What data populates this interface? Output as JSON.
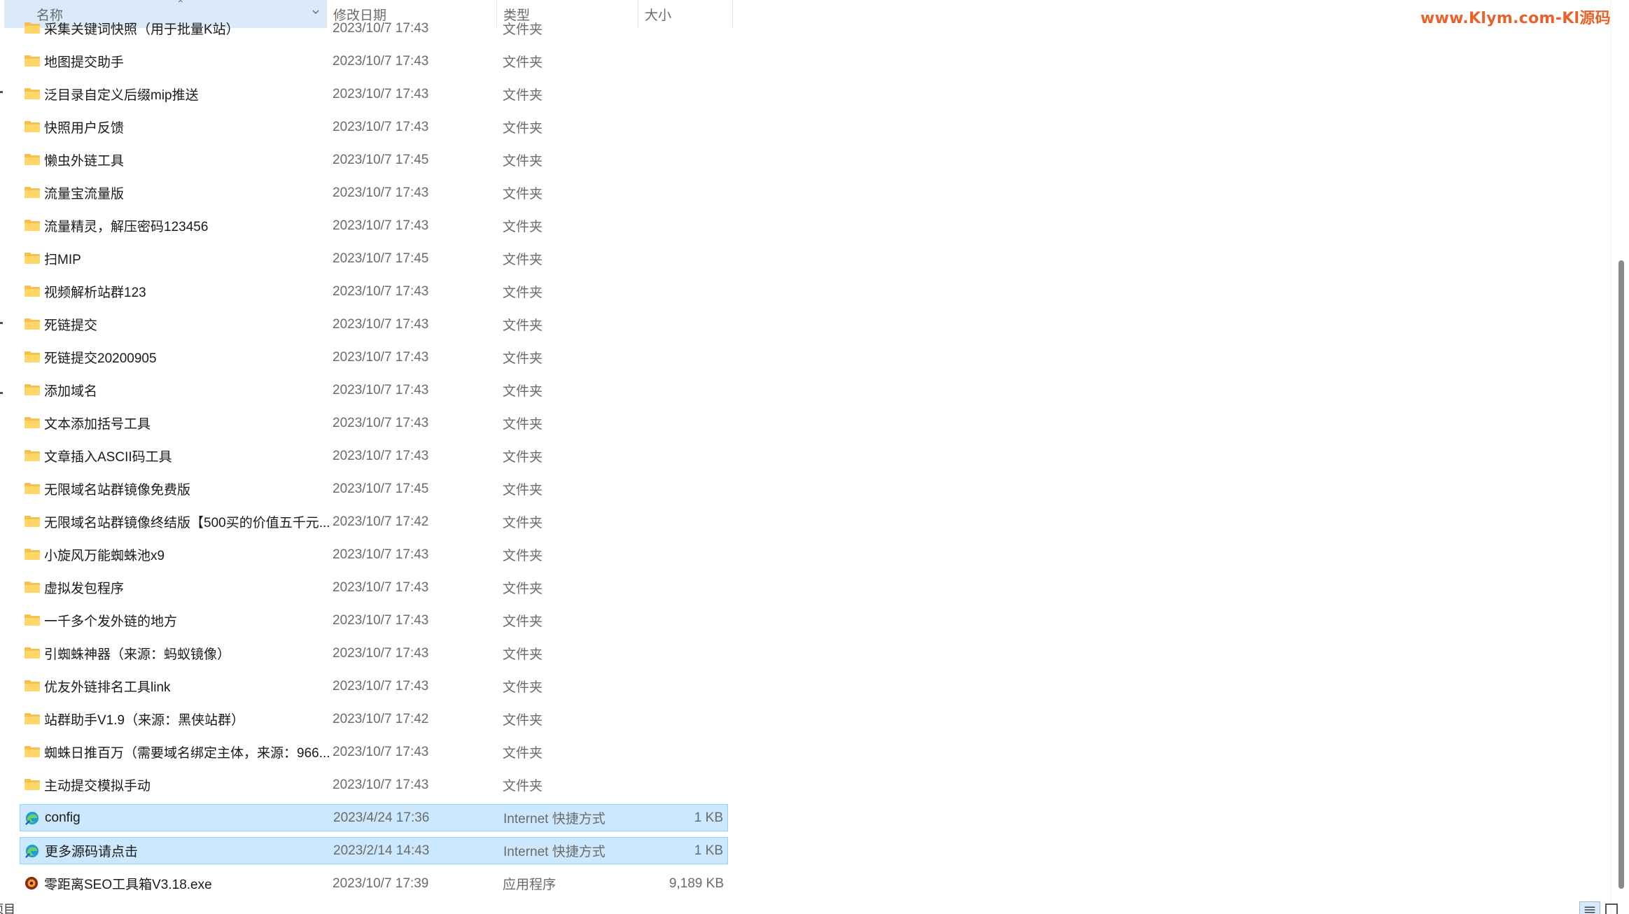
{
  "watermark": "www.Klym.com-Kl源码",
  "columns": {
    "name": "名称",
    "date": "修改日期",
    "type": "类型",
    "size": "大小"
  },
  "rows": [
    {
      "name": "采集关键词快照（用于批量K站）",
      "date": "2023/10/7 17:43",
      "type": "文件夹",
      "size": "",
      "icon": "folder-icon"
    },
    {
      "name": "地图提交助手",
      "date": "2023/10/7 17:43",
      "type": "文件夹",
      "size": "",
      "icon": "folder-icon"
    },
    {
      "name": "泛目录自定义后缀mip推送",
      "date": "2023/10/7 17:43",
      "type": "文件夹",
      "size": "",
      "icon": "folder-icon"
    },
    {
      "name": "快照用户反馈",
      "date": "2023/10/7 17:43",
      "type": "文件夹",
      "size": "",
      "icon": "folder-icon"
    },
    {
      "name": "懒虫外链工具",
      "date": "2023/10/7 17:45",
      "type": "文件夹",
      "size": "",
      "icon": "folder-icon"
    },
    {
      "name": "流量宝流量版",
      "date": "2023/10/7 17:43",
      "type": "文件夹",
      "size": "",
      "icon": "folder-icon"
    },
    {
      "name": "流量精灵，解压密码123456",
      "date": "2023/10/7 17:43",
      "type": "文件夹",
      "size": "",
      "icon": "folder-icon"
    },
    {
      "name": "扫MIP",
      "date": "2023/10/7 17:45",
      "type": "文件夹",
      "size": "",
      "icon": "folder-icon"
    },
    {
      "name": "视频解析站群123",
      "date": "2023/10/7 17:43",
      "type": "文件夹",
      "size": "",
      "icon": "folder-icon"
    },
    {
      "name": "死链提交",
      "date": "2023/10/7 17:43",
      "type": "文件夹",
      "size": "",
      "icon": "folder-icon"
    },
    {
      "name": "死链提交20200905",
      "date": "2023/10/7 17:43",
      "type": "文件夹",
      "size": "",
      "icon": "folder-icon"
    },
    {
      "name": "添加域名",
      "date": "2023/10/7 17:43",
      "type": "文件夹",
      "size": "",
      "icon": "folder-icon"
    },
    {
      "name": "文本添加括号工具",
      "date": "2023/10/7 17:43",
      "type": "文件夹",
      "size": "",
      "icon": "folder-icon"
    },
    {
      "name": "文章插入ASCII码工具",
      "date": "2023/10/7 17:43",
      "type": "文件夹",
      "size": "",
      "icon": "folder-icon"
    },
    {
      "name": "无限域名站群镜像免费版",
      "date": "2023/10/7 17:45",
      "type": "文件夹",
      "size": "",
      "icon": "folder-icon"
    },
    {
      "name": "无限域名站群镜像终结版【500买的价值五千元...",
      "date": "2023/10/7 17:42",
      "type": "文件夹",
      "size": "",
      "icon": "folder-icon"
    },
    {
      "name": "小旋风万能蜘蛛池x9",
      "date": "2023/10/7 17:43",
      "type": "文件夹",
      "size": "",
      "icon": "folder-icon"
    },
    {
      "name": "虚拟发包程序",
      "date": "2023/10/7 17:43",
      "type": "文件夹",
      "size": "",
      "icon": "folder-icon"
    },
    {
      "name": "一千多个发外链的地方",
      "date": "2023/10/7 17:43",
      "type": "文件夹",
      "size": "",
      "icon": "folder-icon"
    },
    {
      "name": "引蜘蛛神器（来源：蚂蚁镜像）",
      "date": "2023/10/7 17:43",
      "type": "文件夹",
      "size": "",
      "icon": "folder-icon"
    },
    {
      "name": "优友外链排名工具link",
      "date": "2023/10/7 17:43",
      "type": "文件夹",
      "size": "",
      "icon": "folder-icon"
    },
    {
      "name": "站群助手V1.9（来源：黑侠站群）",
      "date": "2023/10/7 17:42",
      "type": "文件夹",
      "size": "",
      "icon": "folder-icon"
    },
    {
      "name": "蜘蛛日推百万（需要域名绑定主体，来源：966...",
      "date": "2023/10/7 17:43",
      "type": "文件夹",
      "size": "",
      "icon": "folder-icon"
    },
    {
      "name": "主动提交模拟手动",
      "date": "2023/10/7 17:43",
      "type": "文件夹",
      "size": "",
      "icon": "folder-icon"
    },
    {
      "name": "config",
      "date": "2023/4/24 17:36",
      "type": "Internet 快捷方式",
      "size": "1 KB",
      "icon": "edge-shortcut-icon",
      "selected": true
    },
    {
      "name": "更多源码请点击",
      "date": "2023/2/14 14:43",
      "type": "Internet 快捷方式",
      "size": "1 KB",
      "icon": "edge-shortcut-icon",
      "selected": true
    },
    {
      "name": "零距离SEO工具箱V3.18.exe",
      "date": "2023/10/7 17:39",
      "type": "应用程序",
      "size": "9,189 KB",
      "icon": "app-exe-icon"
    }
  ],
  "status": {
    "items_label": "项目"
  }
}
